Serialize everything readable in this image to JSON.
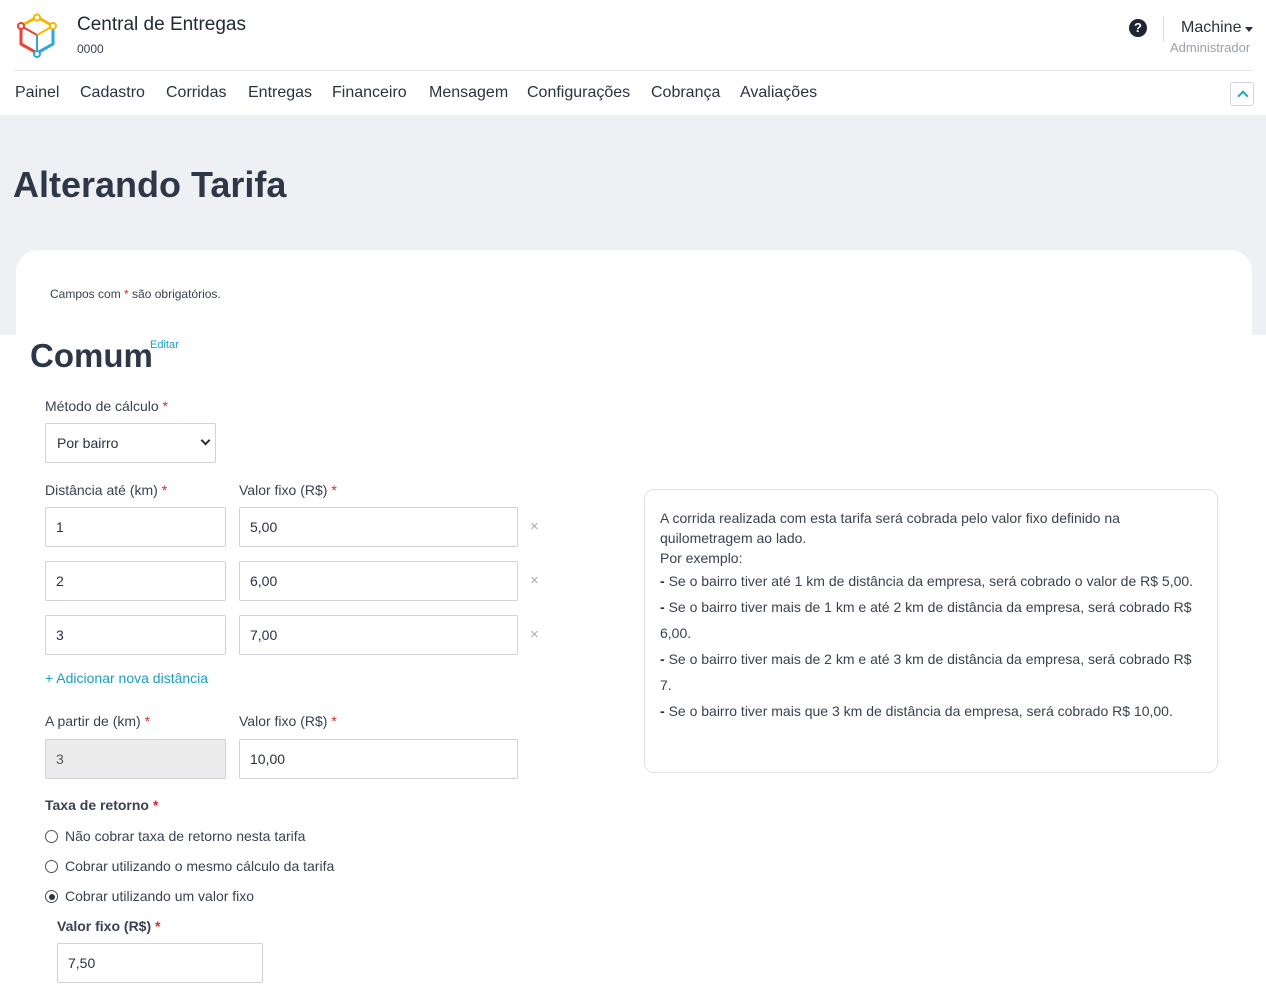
{
  "header": {
    "title": "Central de Entregas",
    "subtitle": "0000",
    "user_name": "Machine",
    "user_role": "Administrador",
    "help_icon": "question-circle-icon",
    "logo_colors": [
      "#f2b705",
      "#e8423a",
      "#2ea7db",
      "#2ea7db"
    ]
  },
  "nav": {
    "items": [
      "Painel",
      "Cadastro",
      "Corridas",
      "Entregas",
      "Financeiro",
      "Mensagem",
      "Configurações",
      "Cobrança",
      "Avaliações"
    ]
  },
  "page": {
    "title": "Alterando Tarifa",
    "required_note_prefix": "Campos com",
    "required_star": "*",
    "required_note_suffix": "são obrigatórios."
  },
  "section": {
    "title": "Comum",
    "edit_label": "Editar"
  },
  "form": {
    "calc_method_label": "Método de cálculo",
    "calc_method_value": "Por bairro",
    "distance_label": "Distância até (km)",
    "fixed_value_label": "Valor fixo (R$)",
    "rows": [
      {
        "distance": "1",
        "value": "5,00"
      },
      {
        "distance": "2",
        "value": "6,00"
      },
      {
        "distance": "3",
        "value": "7,00"
      }
    ],
    "remove_symbol": "×",
    "add_distance_label": "+ Adicionar nova distância",
    "from_label": "A partir de (km)",
    "from_value": "3",
    "from_fixed_label": "Valor fixo (R$)",
    "from_fixed_value": "10,00",
    "return_fee_label": "Taxa de retorno",
    "return_options": [
      {
        "label": "Não cobrar taxa de retorno nesta tarifa",
        "checked": false
      },
      {
        "label": "Cobrar utilizando o mesmo cálculo da tarifa",
        "checked": false
      },
      {
        "label": "Cobrar utilizando um valor fixo",
        "checked": true
      }
    ],
    "return_fixed_label": "Valor fixo (R$)",
    "return_fixed_value": "7,50"
  },
  "info": {
    "intro": "A corrida realizada com esta tarifa será cobrada pelo valor fixo definido na quilometragem ao lado.",
    "example_label": "Por exemplo:",
    "bullets": [
      "Se o bairro tiver até 1 km de distância da empresa, será cobrado o valor de R$ 5,00.",
      "Se o bairro tiver mais de 1 km e até 2 km de distância da empresa, será cobrado R$ 6,00.",
      "Se o bairro tiver mais de 2 km e até 3 km de distância da empresa, será cobrado R$ 7.",
      "Se o bairro tiver mais que 3 km de distância da empresa, será cobrado R$ 10,00."
    ],
    "bullet_marker": "-"
  },
  "colors": {
    "accent": "#1a9fc2",
    "required": "#d22b2b",
    "heading": "#2d3748",
    "band": "#eef0f3"
  }
}
